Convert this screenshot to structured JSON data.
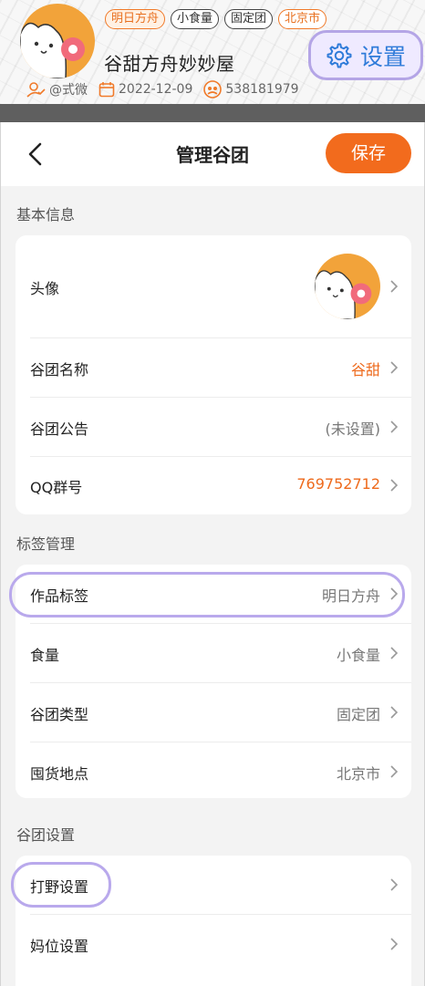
{
  "profile": {
    "tags": [
      "明日方舟",
      "小食量",
      "固定团",
      "北京市"
    ],
    "group_title": "谷甜方舟妙妙屋",
    "creator": "@式微",
    "created_date": "2022-12-09",
    "group_number": "538181979",
    "settings_label": "设置"
  },
  "nav": {
    "title": "管理谷团",
    "save_label": "保存"
  },
  "sections": {
    "basic": "基本信息",
    "tags": "标签管理",
    "settings": "谷团设置"
  },
  "basic_rows": {
    "avatar": "头像",
    "name_label": "谷团名称",
    "name_value": "谷甜",
    "notice_label": "谷团公告",
    "notice_value": "(未设置)",
    "qq_label": "QQ群号",
    "qq_value": "769752712"
  },
  "tag_rows": {
    "work_label": "作品标签",
    "work_value": "明日方舟",
    "appetite_label": "食量",
    "appetite_value": "小食量",
    "type_label": "谷团类型",
    "type_value": "固定团",
    "location_label": "囤货地点",
    "location_value": "北京市"
  },
  "settings_rows": {
    "wild_label": "打野设置",
    "slot_label": "妈位设置"
  },
  "colors": {
    "accent": "#f26b1d",
    "highlight": "#b9a9ec",
    "settings_text": "#2f7bd9"
  }
}
